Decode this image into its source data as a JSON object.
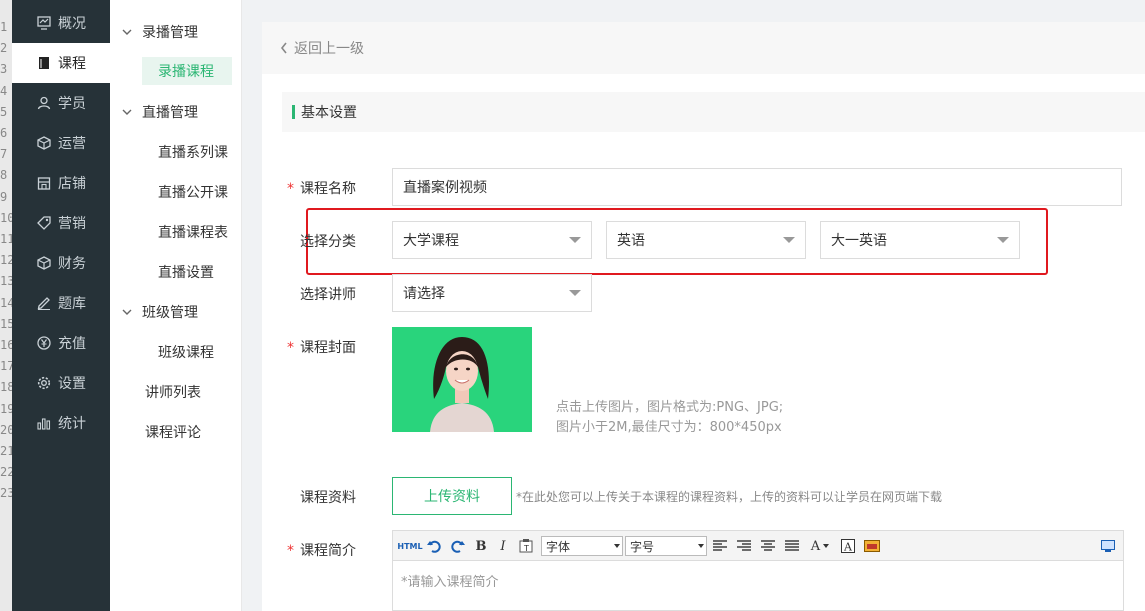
{
  "gutter_numbers": [
    "1",
    "2",
    "3",
    "4",
    "5",
    "6",
    "7",
    "8",
    "9",
    "10",
    "11",
    "12",
    "13",
    "14",
    "15",
    "16",
    "17",
    "18",
    "19",
    "20",
    "21",
    "22",
    "23"
  ],
  "sidebar": {
    "items": [
      {
        "label": "概况",
        "icon": "dashboard-icon"
      },
      {
        "label": "课程",
        "icon": "book-icon"
      },
      {
        "label": "学员",
        "icon": "user-icon"
      },
      {
        "label": "运营",
        "icon": "cube-icon"
      },
      {
        "label": "店铺",
        "icon": "store-icon"
      },
      {
        "label": "营销",
        "icon": "tag-icon"
      },
      {
        "label": "财务",
        "icon": "cube-icon"
      },
      {
        "label": "题库",
        "icon": "pencil-icon"
      },
      {
        "label": "充值",
        "icon": "yen-icon"
      },
      {
        "label": "设置",
        "icon": "gear-icon"
      },
      {
        "label": "统计",
        "icon": "bar-chart-icon"
      }
    ],
    "active_index": 1
  },
  "submenu": {
    "group_recorded": "录播管理",
    "item_recorded_courses": "录播课程",
    "group_live": "直播管理",
    "item_live_series": "直播系列课",
    "item_live_open": "直播公开课",
    "item_live_schedule": "直播课程表",
    "item_live_settings": "直播设置",
    "group_class": "班级管理",
    "item_class_courses": "班级课程",
    "item_teacher_list": "讲师列表",
    "item_course_reviews": "课程评论"
  },
  "back_link": "返回上一级",
  "section_title": "基本设置",
  "form": {
    "course_name_label": "课程名称",
    "course_name_value": "直播案例视频",
    "category_label": "选择分类",
    "category_1": "大学课程",
    "category_2": "英语",
    "category_3": "大一英语",
    "teacher_label": "选择讲师",
    "teacher_value": "请选择",
    "cover_label": "课程封面",
    "cover_hint_1": "点击上传图片，图片格式为:PNG、JPG;",
    "cover_hint_2": "图片小于2M,最佳尺寸为：800*450px",
    "material_label": "课程资料",
    "upload_button": "上传资料",
    "upload_note": "*在此处您可以上传关于本课程的课程资料，上传的资料可以让学员在网页端下载",
    "intro_label": "课程简介",
    "intro_placeholder": "*请输入课程简介",
    "required_mark": "*"
  },
  "toolbar": {
    "html_label": "HTML",
    "bold": "B",
    "italic": "I",
    "font_family": "字体",
    "font_size": "字号",
    "font_color": "A"
  },
  "colors": {
    "sidebar_bg": "#263238",
    "accent_green": "#2bb673",
    "highlight_red": "#e0191f",
    "cover_bg": "#29d47c"
  }
}
